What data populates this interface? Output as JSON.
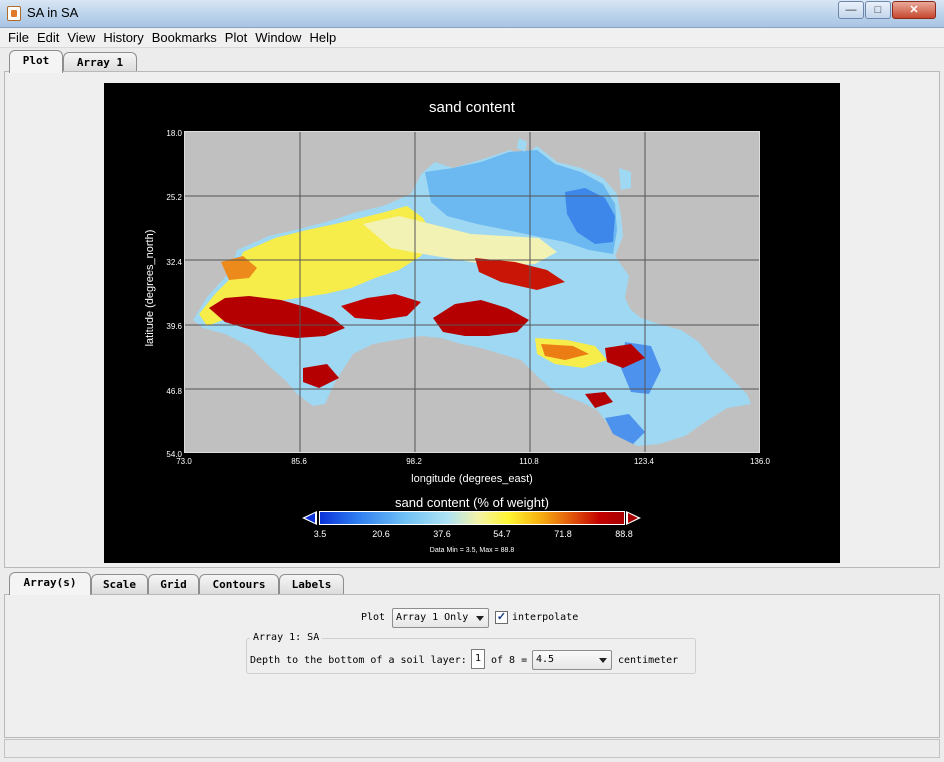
{
  "window": {
    "title": "SA in SA",
    "controls": {
      "minimize": "—",
      "maximize": "□",
      "close": "✕"
    }
  },
  "menu": [
    "File",
    "Edit",
    "View",
    "History",
    "Bookmarks",
    "Plot",
    "Window",
    "Help"
  ],
  "top_tabs": [
    "Plot",
    "Array 1"
  ],
  "plot": {
    "title": "sand content",
    "xlabel": "longitude (degrees_east)",
    "ylabel": "latitude (degrees_north)",
    "xticks": [
      "73.0",
      "85.6",
      "98.2",
      "110.8",
      "123.4",
      "136.0"
    ],
    "yticks": [
      "18.0",
      "25.2",
      "32.4",
      "39.6",
      "46.8",
      "54.0"
    ],
    "colorbar": {
      "title": "sand content (% of weight)",
      "ticks": [
        "3.5",
        "20.6",
        "37.6",
        "54.7",
        "71.8",
        "88.8"
      ]
    },
    "data_range": "Data Min = 3.5, Max = 88.8"
  },
  "bottom_tabs": [
    "Array(s)",
    "Scale",
    "Grid",
    "Contours",
    "Labels"
  ],
  "controls": {
    "plot_label": "Plot",
    "plot_select": "Array 1 Only",
    "interpolate_label": "interpolate",
    "interpolate_checked": "✓",
    "group_title": "Array 1: SA",
    "depth_label": "Depth to the bottom of a soil layer:",
    "depth_index": "1",
    "depth_of": "of 8 =",
    "depth_value": "4.5",
    "depth_unit": "centimeter"
  }
}
